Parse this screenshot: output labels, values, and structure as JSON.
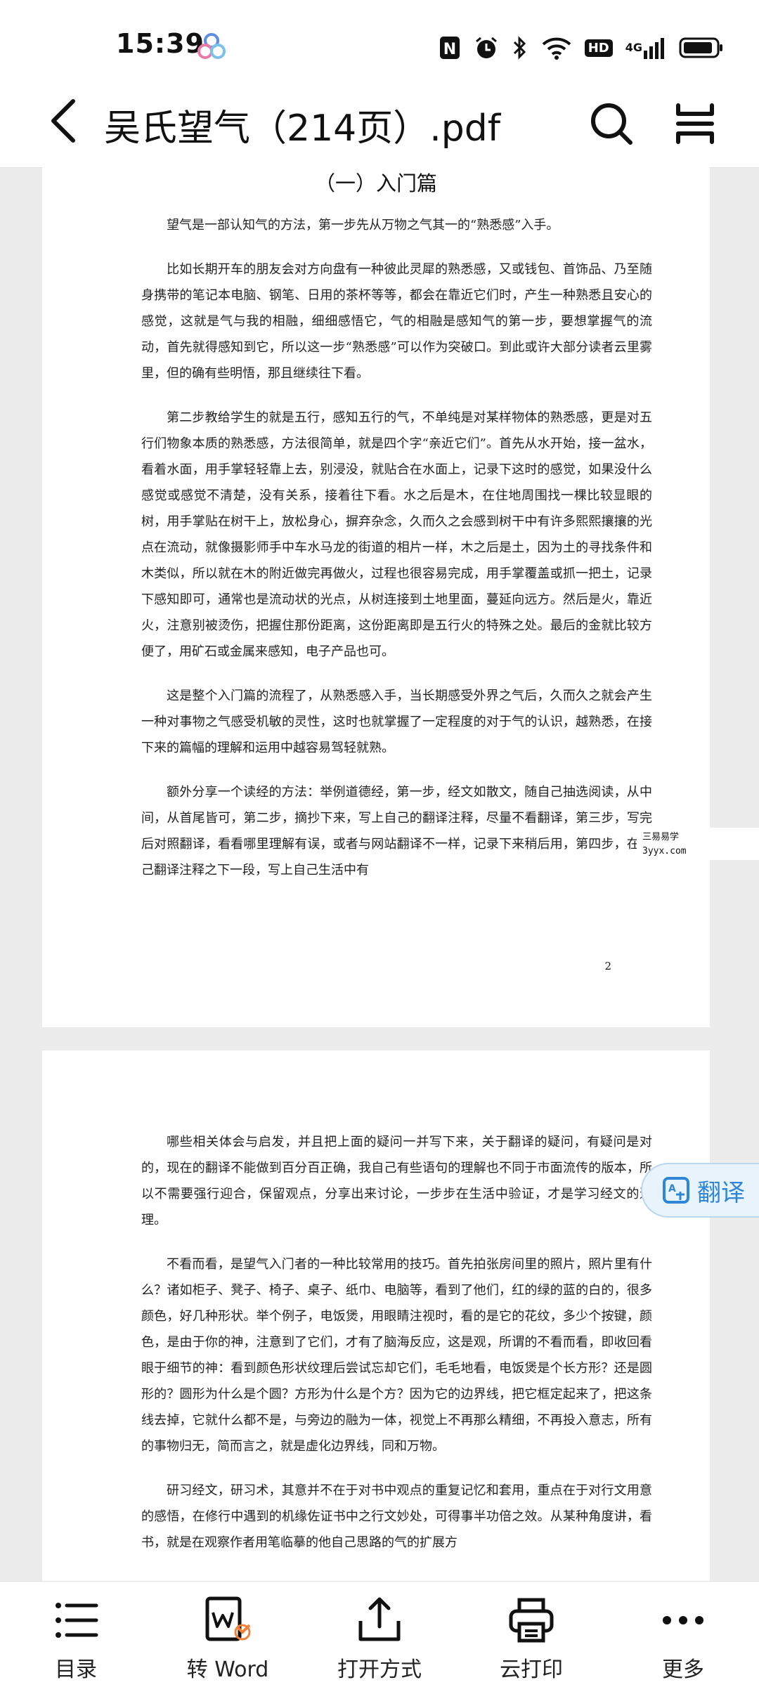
{
  "status_bar": {
    "time": "15:39",
    "nfc_label": "N",
    "hd_label": "HD",
    "network_label": "4G",
    "battery_level": 0.9
  },
  "title_bar": {
    "title": "吴氏望气（214页）.pdf"
  },
  "page1": {
    "chapter": "（一）入门篇",
    "paragraphs": [
      "望气是一部认知气的方法，第一步先从万物之气其一的“熟悉感”入手。",
      "比如长期开车的朋友会对方向盘有一种彼此灵犀的熟悉感，又或钱包、首饰品、乃至随身携带的笔记本电脑、钢笔、日用的茶杯等等，都会在靠近它们时，产生一种熟悉且安心的感觉，这就是气与我的相融，细细感悟它，气的相融是感知气的第一步，要想掌握气的流动，首先就得感知到它，所以这一步“熟悉感”可以作为突破口。到此或许大部分读者云里雾里，但的确有些明悟，那且继续往下看。",
      "第二步教给学生的就是五行，感知五行的气，不单纯是对某样物体的熟悉感，更是对五行们物象本质的熟悉感，方法很简单，就是四个字“亲近它们”。首先从水开始，接一盆水，看着水面，用手掌轻轻靠上去，别浸没，就贴合在水面上，记录下这时的感觉，如果没什么感觉或感觉不清楚，没有关系，接着往下看。水之后是木，在住地周围找一棵比较显眼的树，用手掌贴在树干上，放松身心，摒弃杂念，久而久之会感到树干中有许多熙熙攘攘的光点在流动，就像摄影师手中车水马龙的街道的相片一样，木之后是土，因为土的寻找条件和木类似，所以就在木的附近做完再做火，过程也很容易完成，用手掌覆盖或抓一把土，记录下感知即可，通常也是流动状的光点，从树连接到土地里面，蔓延向远方。然后是火，靠近火，注意别被烫伤，把握住那份距离，这份距离即是五行火的特殊之处。最后的金就比较方便了，用矿石或金属来感知，电子产品也可。",
      "这是整个入门篇的流程了，从熟悉感入手，当长期感受外界之气后，久而久之就会产生一种对事物之气感受机敏的灵性，这时也就掌握了一定程度的对于气的认识，越熟悉，在接下来的篇幅的理解和运用中越容易驾轻就熟。",
      "额外分享一个读经的方法：举例道德经，第一步，经文如散文，随自己抽选阅读，从中间，从首尾皆可，第二步，摘抄下来，写上自己的翻译注释，尽量不看翻译，第三步，写完后对照翻译，看看哪里理解有误，或者与网站翻译不一样，记录下来稍后用，第四步，在自己翻译注释之下一段，写上自己生活中有"
    ],
    "page_number": "2"
  },
  "watermark": {
    "line1": "三易易学",
    "line2": "3yyx.com"
  },
  "page2": {
    "paragraphs": [
      "哪些相关体会与启发，并且把上面的疑问一并写下来，关于翻译的疑问，有疑问是对的，现在的翻译不能做到百分百正确，我自己有些语句的理解也不同于市面流传的版本，所以不需要强行迎合，保留观点，分享出来讨论，一步步在生活中验证，才是学习经文的道理。",
      "不看而看，是望气入门者的一种比较常用的技巧。首先拍张房间里的照片，照片里有什么？诸如柜子、凳子、椅子、桌子、纸巾、电脑等，看到了他们，红的绿的蓝的白的，很多颜色，好几种形状。举个例子，电饭煲，用眼睛注视时，看的是它的花纹，多少个按键，颜色，是由于你的神，注意到了它们，才有了脑海反应，这是观，所谓的不看而看，即收回看眼于细节的神：看到颜色形状纹理后尝试忘却它们，毛毛地看，电饭煲是个长方形？还是圆形的？圆形为什么是个圆？方形为什么是个方？因为它的边界线，把它框定起来了，把这条线去掉，它就什么都不是，与旁边的融为一体，视觉上不再那么精细，不再投入意志，所有的事物归无，简而言之，就是虚化边界线，同和万物。",
      "研习经文，研习术，其意并不在于对书中观点的重复记忆和套用，重点在于对行文用意的感悟，在修行中遇到的机缘佐证书中之行文妙处，可得事半功倍之效。从某种角度讲，看书，就是在观察作者用笔临摹的他自己思路的气的扩展方"
    ]
  },
  "translate_button": {
    "label": "翻译"
  },
  "bottom_bar": {
    "items": [
      {
        "label": "目录",
        "icon": "list-icon"
      },
      {
        "label": "转 Word",
        "icon": "convert-word-icon"
      },
      {
        "label": "打开方式",
        "icon": "share-icon"
      },
      {
        "label": "云打印",
        "icon": "printer-icon"
      },
      {
        "label": "更多",
        "icon": "more-icon"
      }
    ]
  }
}
